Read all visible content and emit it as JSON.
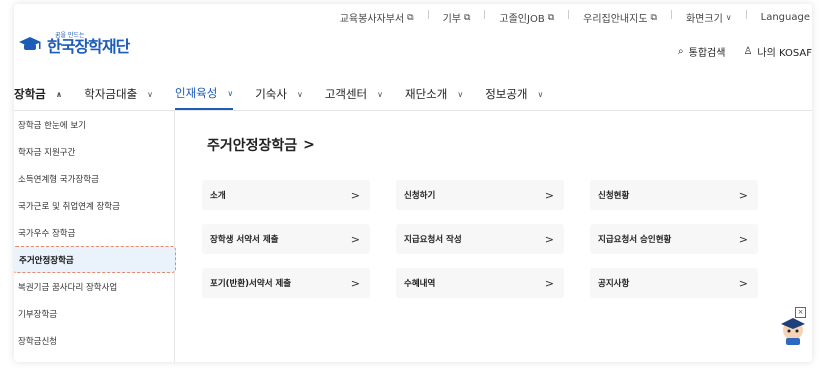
{
  "top_links": [
    {
      "label": "교육봉사자부서",
      "icon": "external-link-icon"
    },
    {
      "label": "기부",
      "icon": "external-link-icon"
    },
    {
      "label": "고졸인JOB",
      "icon": "external-link-icon"
    },
    {
      "label": "우리집안내지도",
      "icon": "external-link-icon"
    },
    {
      "label": "화면크기",
      "icon": "chevron-down-icon"
    },
    {
      "label": "Language"
    }
  ],
  "logo": {
    "small": "꿈을 만드는",
    "main": "한국장학재단"
  },
  "header_right": {
    "search": "통합검색",
    "my": "나의 KOSAF"
  },
  "gnb": [
    {
      "label": "장학금",
      "icon": "chevron-up-icon"
    },
    {
      "label": "학자금대출",
      "icon": "chevron-down-icon"
    },
    {
      "label": "인재육성",
      "icon": "chevron-down-icon"
    },
    {
      "label": "기숙사",
      "icon": "chevron-down-icon"
    },
    {
      "label": "고객센터",
      "icon": "chevron-down-icon"
    },
    {
      "label": "재단소개",
      "icon": "chevron-down-icon"
    },
    {
      "label": "정보공개",
      "icon": "chevron-down-icon"
    }
  ],
  "lnb": [
    "장학금 한눈에 보기",
    "학자금 지원구간",
    "소득연계형 국가장학금",
    "국가근로 및 취업연계 장학금",
    "국가우수 장학금",
    "주거안정장학금",
    "복권기금 꿈사다리 장학사업",
    "기부장학금",
    "장학금신청"
  ],
  "content": {
    "title": "주거안정장학금",
    "title_arrow": ">",
    "cards": [
      "소개",
      "신청하기",
      "신청현황",
      "장학생 서약서 제출",
      "지급요청서 작성",
      "지급요청서 승인현황",
      "포기(반환)서약서 제출",
      "수혜내역",
      "공지사항"
    ],
    "card_arrow": ">"
  },
  "floating": {
    "close": "×"
  },
  "colors": {
    "brand_blue": "#1d5db8",
    "selected_bg": "#eaf3fc",
    "selected_border": "#e58a6a",
    "card_bg": "#f7f7f7"
  }
}
